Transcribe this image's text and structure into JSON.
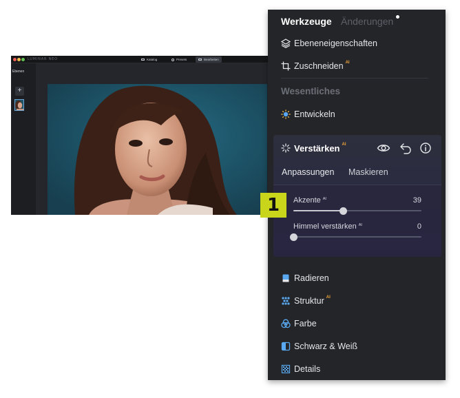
{
  "app_window": {
    "logo": "LUMINAR NEO",
    "tabs": [
      {
        "label": "Katalog"
      },
      {
        "label": "Presets"
      },
      {
        "label": "Bearbeiten"
      }
    ],
    "layers_label": "Ebenen",
    "add_layer_symbol": "+"
  },
  "callout": {
    "number": "1"
  },
  "panel": {
    "tabs": {
      "tools": "Werkzeuge",
      "changes": "Änderungen"
    },
    "items_top": [
      {
        "label": "Ebeneneigenschaften",
        "icon": "layers-icon",
        "ai": ""
      },
      {
        "label": "Zuschneiden",
        "icon": "crop-icon",
        "ai": "AI"
      }
    ],
    "section_title": "Wesentliches",
    "develop": {
      "label": "Entwickeln",
      "icon": "sun-icon"
    },
    "enhance": {
      "label": "Verstärken",
      "ai": "AI",
      "tabs": {
        "adjust": "Anpassungen",
        "mask": "Maskieren"
      },
      "sliders": [
        {
          "label": "Akzente",
          "ai": "AI",
          "value": 39,
          "min": 0,
          "max": 100
        },
        {
          "label": "Himmel verstärken",
          "ai": "AI",
          "value": 0,
          "min": 0,
          "max": 100
        }
      ]
    },
    "items_bottom": [
      {
        "label": "Radieren",
        "icon": "eraser-icon",
        "ai": ""
      },
      {
        "label": "Struktur",
        "icon": "structure-icon",
        "ai": "AI"
      },
      {
        "label": "Farbe",
        "icon": "color-icon",
        "ai": ""
      },
      {
        "label": "Schwarz & Weiß",
        "icon": "black-white-icon",
        "ai": ""
      },
      {
        "label": "Details",
        "icon": "details-icon",
        "ai": ""
      }
    ]
  },
  "colors": {
    "panel_bg": "#232529",
    "accent_ai": "#f0a43a",
    "callout": "#c8d51b",
    "icon_blue": "#5aa8f0"
  }
}
